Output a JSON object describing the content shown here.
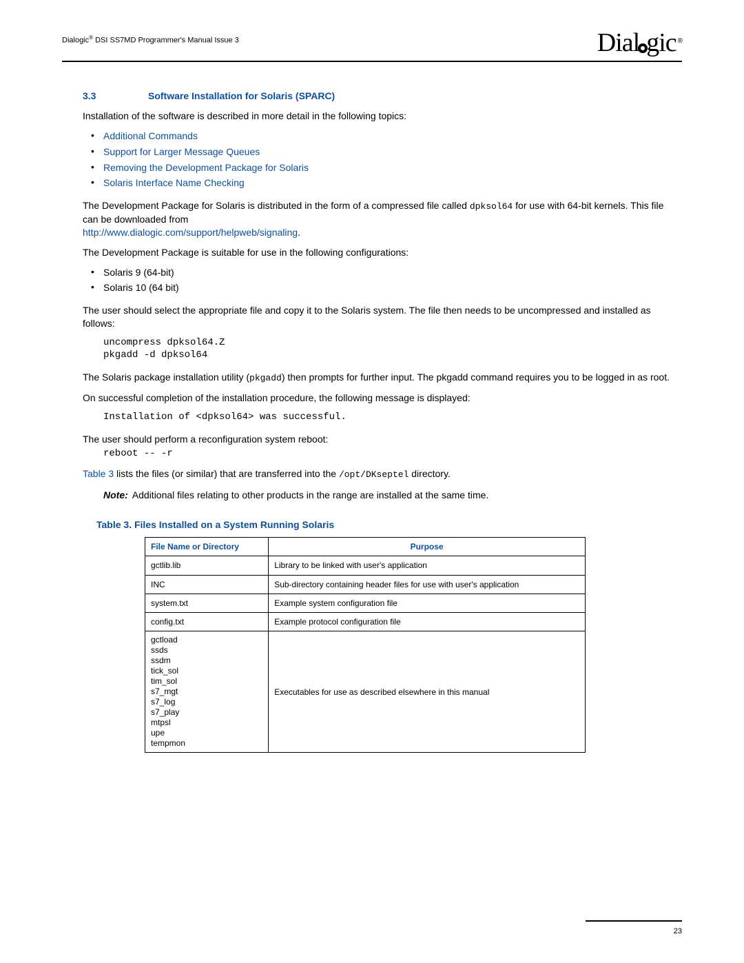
{
  "header": {
    "doc_line_prefix": "Dialogic",
    "doc_line_suffix": " DSI SS7MD Programmer's Manual  Issue 3",
    "logo_left": "Dial",
    "logo_right": "gic",
    "logo_reg": "®"
  },
  "section": {
    "number": "3.3",
    "title": "Software Installation for Solaris (SPARC)"
  },
  "intro": "Installation of the software is described in more detail in the following topics:",
  "topics": [
    "Additional Commands",
    "Support for Larger Message Queues",
    "Removing the Development Package for Solaris",
    "Solaris Interface Name Checking"
  ],
  "para_devpkg_1": "The Development Package for Solaris is distributed in the form of a compressed file called ",
  "para_devpkg_file": "dpksol64",
  "para_devpkg_2": " for use with 64-bit kernels. This file can be downloaded from ",
  "link_url": "http://www.dialogic.com/support/helpweb/signaling",
  "para_devpkg_3": ".",
  "para_suitable": "The Development Package is suitable for use in the following configurations:",
  "configs": [
    "Solaris 9 (64-bit)",
    "Solaris 10 (64 bit)"
  ],
  "para_select": "The user should select the appropriate file and copy it to the Solaris system. The file then needs to be uncompressed and installed as follows:",
  "code_install": "uncompress dpksol64.Z\npkgadd -d dpksol64",
  "para_pkgadd_1": "The Solaris package installation utility (",
  "para_pkgadd_cmd": "pkgadd",
  "para_pkgadd_2": ") then prompts for further input. The pkgadd command requires you to be logged in as root.",
  "para_success": "On successful completion of the installation procedure, the following message is displayed:",
  "code_success": "Installation of <dpksol64> was successful.",
  "para_reboot": "The user should perform a reconfiguration system reboot:",
  "code_reboot": "reboot -- -r",
  "para_table_1a": "Table 3",
  "para_table_1b": " lists the files (or similar) that are transferred into the ",
  "para_table_path": "/opt/DKseptel",
  "para_table_1c": " directory.",
  "note_label": "Note:",
  "note_text": "Additional files relating to other products in the range are installed at the same time.",
  "table": {
    "caption": "Table 3.  Files Installed on a System Running Solaris",
    "col1": "File Name or Directory",
    "col2": "Purpose",
    "rows": [
      {
        "name": "gctlib.lib",
        "purpose": "Library to be linked with user's application"
      },
      {
        "name": "INC",
        "purpose": "Sub-directory containing header files for use with user's application"
      },
      {
        "name": "system.txt",
        "purpose": "Example system configuration file"
      },
      {
        "name": "config.txt",
        "purpose": "Example protocol configuration file"
      },
      {
        "name": "gctload\nssds\nssdm\ntick_sol\ntim_sol\ns7_mgt\ns7_log\ns7_play\nmtpsl\nupe\ntempmon",
        "purpose": "Executables for use as described elsewhere in this manual"
      }
    ]
  },
  "page_number": "23"
}
